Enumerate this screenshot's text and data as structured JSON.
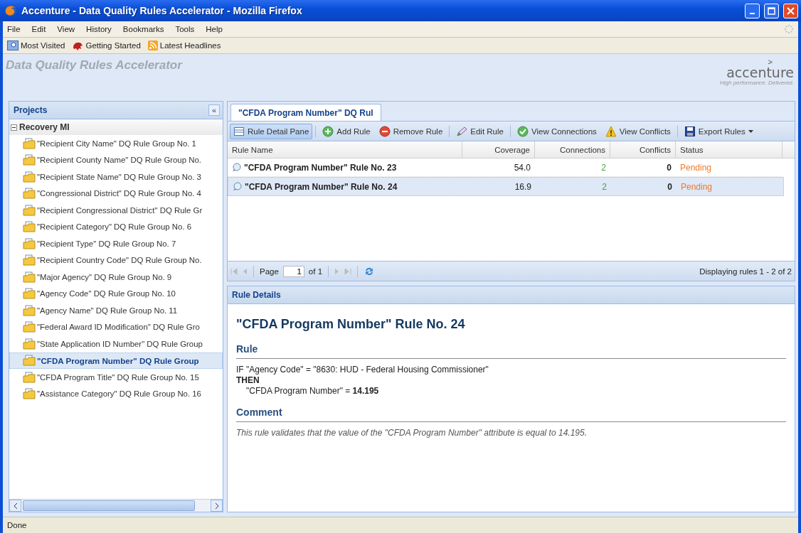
{
  "window": {
    "title": "Accenture - Data Quality Rules Accelerator - Mozilla Firefox"
  },
  "menu": [
    "File",
    "Edit",
    "View",
    "History",
    "Bookmarks",
    "Tools",
    "Help"
  ],
  "bookmarks": [
    "Most Visited",
    "Getting Started",
    "Latest Headlines"
  ],
  "app": {
    "title": "Data Quality Rules Accelerator",
    "logo": {
      "mark": ">",
      "name": "accenture",
      "tagline": "High performance. Delivered."
    }
  },
  "projects": {
    "title": "Projects",
    "collapse": "«",
    "tree": [
      {
        "label": "Recovery MI",
        "expanded": true,
        "children": [
          {
            "label": "\"Recipient City Name\" DQ Rule Group No. 1",
            "selected": false
          },
          {
            "label": "\"Recipient County Name\" DQ Rule Group No.",
            "selected": false
          },
          {
            "label": "\"Recipient State Name\" DQ Rule Group No. 3",
            "selected": false
          },
          {
            "label": "\"Congressional District\" DQ Rule Group No. 4",
            "selected": false
          },
          {
            "label": "\"Recipient Congressional District\" DQ Rule Gr",
            "selected": false
          },
          {
            "label": "\"Recipient Category\" DQ Rule Group No. 6",
            "selected": false
          },
          {
            "label": "\"Recipient Type\" DQ Rule Group No. 7",
            "selected": false
          },
          {
            "label": "\"Recipient Country Code\" DQ Rule Group No.",
            "selected": false
          },
          {
            "label": "\"Major Agency\" DQ Rule Group No. 9",
            "selected": false
          },
          {
            "label": "\"Agency Code\" DQ Rule Group No. 10",
            "selected": false
          },
          {
            "label": "\"Agency Name\" DQ Rule Group No. 11",
            "selected": false
          },
          {
            "label": "\"Federal Award ID Modification\" DQ Rule Gro",
            "selected": false
          },
          {
            "label": "\"State Application ID Number\" DQ Rule Group",
            "selected": false
          },
          {
            "label": "\"CFDA Program Number\" DQ Rule Group",
            "selected": true
          },
          {
            "label": "\"CFDA Program Title\" DQ Rule Group No. 15",
            "selected": false
          },
          {
            "label": "\"Assistance Category\" DQ Rule Group No. 16",
            "selected": false
          }
        ]
      }
    ]
  },
  "tabs": [
    {
      "label": "\"CFDA Program Number\" DQ Rul",
      "selected": true
    }
  ],
  "toolbar": [
    {
      "label": "Rule Detail Pane",
      "pressed": true
    },
    {
      "label": "Add Rule",
      "pressed": false
    },
    {
      "label": "Remove Rule",
      "pressed": false
    },
    {
      "label": "Edit Rule",
      "pressed": false
    },
    {
      "label": "View Connections",
      "pressed": false
    },
    {
      "label": "View Conflicts",
      "pressed": false
    },
    {
      "label": "Export Rules",
      "pressed": false
    }
  ],
  "table": {
    "columns": [
      "Rule Name",
      "Coverage",
      "Connections",
      "Conflicts",
      "Status"
    ],
    "rows": [
      {
        "name": "\"CFDA Program Number\" Rule No. 23",
        "coverage": "54.0",
        "connections": "2",
        "conflicts": "0",
        "status": "Pending",
        "selected": false
      },
      {
        "name": "\"CFDA Program Number\" Rule No. 24",
        "coverage": "16.9",
        "connections": "2",
        "conflicts": "0",
        "status": "Pending",
        "selected": true
      }
    ]
  },
  "pager": {
    "page_label": "Page",
    "page": "1",
    "of": "of 1",
    "summary": "Displaying rules 1 - 2 of 2"
  },
  "details": {
    "header": "Rule Details",
    "title": "\"CFDA Program Number\" Rule No. 24",
    "rule_heading": "Rule",
    "rule_lines": [
      "IF \"Agency Code\" = \"8630: HUD - Federal Housing Commissioner\"",
      "THEN",
      "\"CFDA Program Number\" = **14.195**"
    ],
    "comment_heading": "Comment",
    "comment": "This rule validates that the value of the \"CFDA Program Number\" attribute is equal to 14.195."
  },
  "status_bar": "Done"
}
